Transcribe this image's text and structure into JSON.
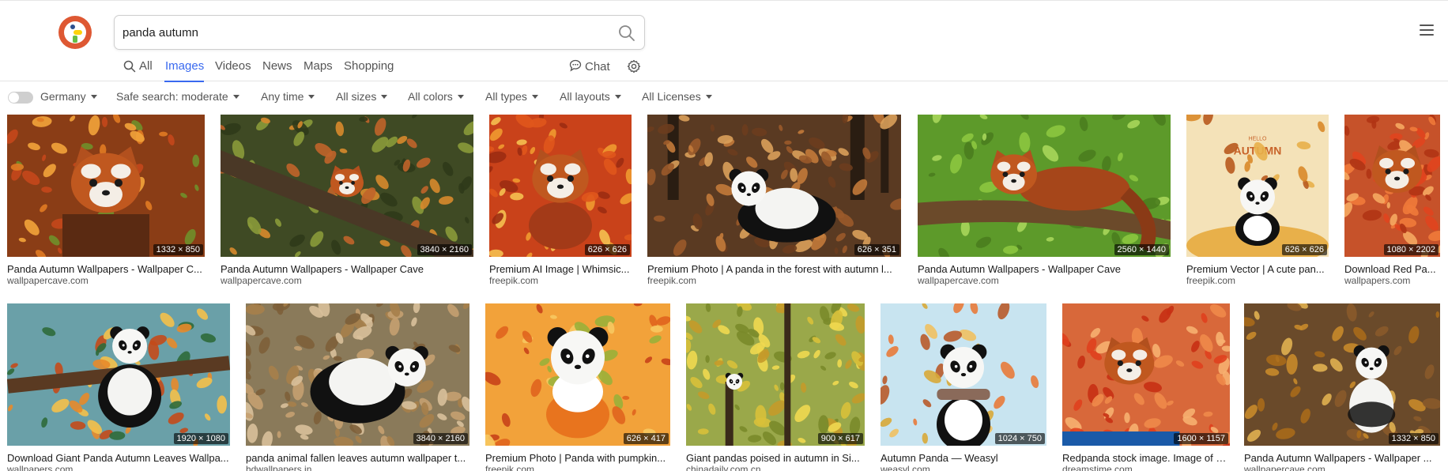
{
  "search": {
    "query": "panda autumn"
  },
  "nav": {
    "all": "All",
    "images": "Images",
    "videos": "Videos",
    "news": "News",
    "maps": "Maps",
    "shopping": "Shopping",
    "chat": "Chat",
    "active": "Images"
  },
  "filters": {
    "region": "Germany",
    "safe_search": "Safe search: moderate",
    "time": "Any time",
    "size": "All sizes",
    "color": "All colors",
    "type": "All types",
    "layout": "All layouts",
    "license": "All Licenses"
  },
  "colors": {
    "accent": "#3969ef",
    "brand": "#de5833"
  },
  "results": [
    {
      "title": "Panda Autumn Wallpapers - Wallpaper C...",
      "source": "wallpapercave.com",
      "dims": "1332 × 850",
      "subject": "red-panda"
    },
    {
      "title": "Panda Autumn Wallpapers - Wallpaper Cave",
      "source": "wallpapercave.com",
      "dims": "3840 × 2160",
      "subject": "red-panda-tree"
    },
    {
      "title": "Premium AI Image | Whimsic...",
      "source": "freepik.com",
      "dims": "626 × 626",
      "subject": "red-panda-cartoon"
    },
    {
      "title": "Premium Photo | A panda in the forest with autumn l...",
      "source": "freepik.com",
      "dims": "626 × 351",
      "subject": "giant-panda-forest"
    },
    {
      "title": "Panda Autumn Wallpapers - Wallpaper Cave",
      "source": "wallpapercave.com",
      "dims": "2560 × 1440",
      "subject": "red-panda-branch"
    },
    {
      "title": "Premium Vector | A cute pan...",
      "source": "freepik.com",
      "dims": "626 × 626",
      "subject": "hello-autumn",
      "overlay_text": "HELLO AUTUMN"
    },
    {
      "title": "Download Red Pa...",
      "source": "wallpapers.com",
      "dims": "1080 × 2202",
      "subject": "red-panda-leaves"
    },
    {
      "title": "Download Giant Panda Autumn Leaves Wallpa...",
      "source": "wallpapers.com",
      "dims": "1920 × 1080",
      "subject": "giant-panda-fence"
    },
    {
      "title": "panda animal fallen leaves autumn wallpaper t...",
      "source": "hdwallpapers.in",
      "dims": "3840 × 2160",
      "subject": "giant-panda-leaves"
    },
    {
      "title": "Premium Photo | Panda with pumpkin...",
      "source": "freepik.com",
      "dims": "626 × 417",
      "subject": "panda-pumpkin"
    },
    {
      "title": "Giant pandas poised in autumn in Si...",
      "source": "chinadaily.com.cn",
      "dims": "900 × 617",
      "subject": "panda-yellow-tree"
    },
    {
      "title": "Autumn Panda — Weasyl",
      "source": "weasyl.com",
      "dims": "1024 × 750",
      "subject": "panda-scarf"
    },
    {
      "title": "Redpanda stock image. Image of a...",
      "source": "dreamstime.com",
      "dims": "1600 × 1157",
      "subject": "red-panda-maple"
    },
    {
      "title": "Panda Autumn Wallpapers - Wallpaper ...",
      "source": "wallpapercave.com",
      "dims": "1332 × 850",
      "subject": "plush-panda"
    }
  ]
}
